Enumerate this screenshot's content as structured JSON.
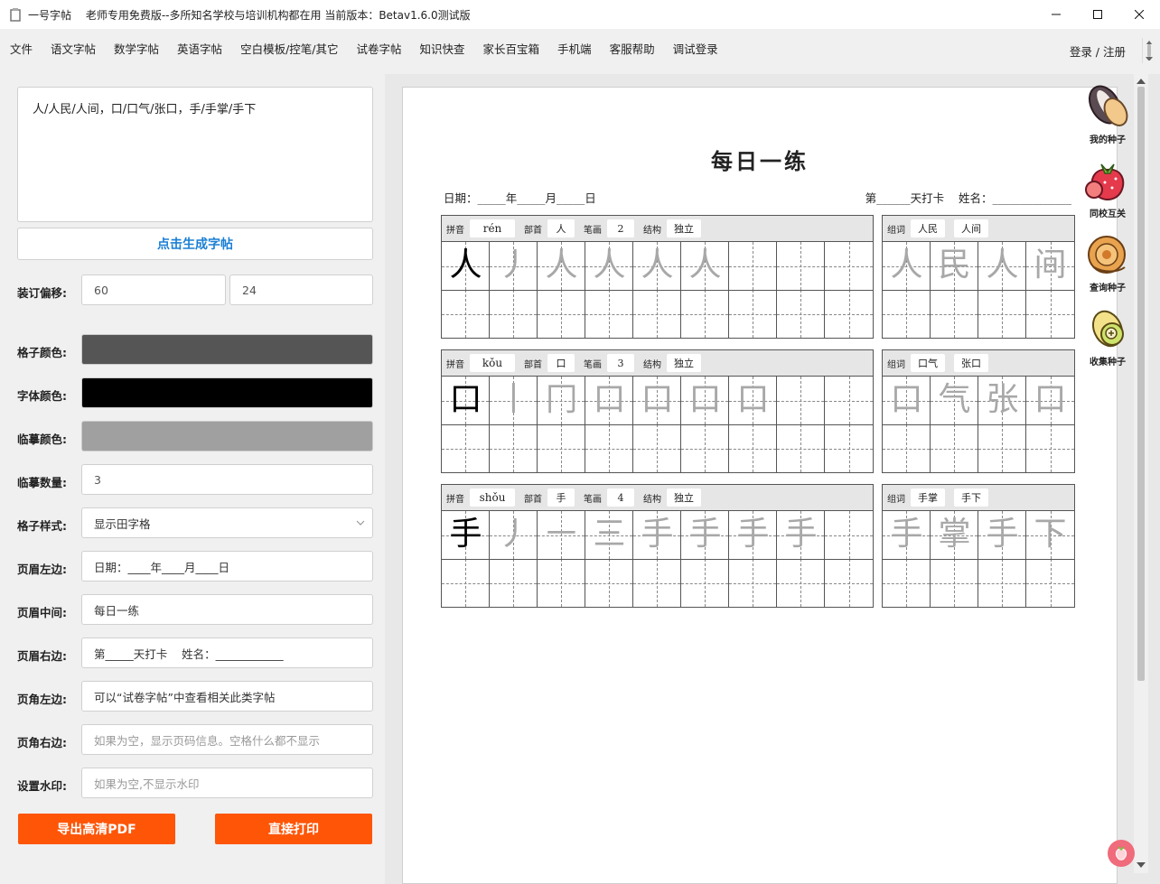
{
  "window": {
    "app_name": "一号字帖",
    "subtitle": "老师专用免费版--多所知名学校与培训机构都在用 当前版本：Betav1.6.0测试版",
    "minimize_icon": "minimize-icon",
    "maximize_icon": "maximize-icon",
    "close_icon": "close-icon"
  },
  "menu": {
    "items": [
      "文件",
      "语文字帖",
      "数学字帖",
      "英语字帖",
      "空白模板/控笔/其它",
      "试卷字帖",
      "知识快查",
      "家长百宝箱",
      "手机端",
      "客服帮助",
      "调试登录"
    ],
    "login": "登录 / 注册"
  },
  "left": {
    "input_text": "人/人民/人间，口/口气/张口，手/手掌/手下",
    "generate_button": "点击生成字帖",
    "binding_label": "装订偏移:",
    "binding_x": "60",
    "binding_y": "24",
    "grid_color_label": "格子颜色:",
    "grid_color": "#555555",
    "font_color_label": "字体颜色:",
    "font_color": "#000000",
    "trace_color_label": "临摹颜色:",
    "trace_color": "#a0a0a0",
    "trace_count_label": "临摹数量:",
    "trace_count": "3",
    "grid_style_label": "格子样式:",
    "grid_style": "显示田字格",
    "header_left_label": "页眉左边:",
    "header_left": "日期：____年____月____日",
    "header_center_label": "页眉中间:",
    "header_center": "每日一练",
    "header_right_label": "页眉右边:",
    "header_right": "第_____天打卡    姓名：____________",
    "footer_left_label": "页角左边:",
    "footer_left": "可以“试卷字帖”中查看相关此类字帖",
    "footer_right_label": "页角右边:",
    "footer_right_placeholder": "如果为空，显示页码信息。空格什么都不显示",
    "watermark_label": "设置水印:",
    "watermark_placeholder": "如果为空,不显示水印",
    "export_button": "导出高清PDF",
    "print_button": "直接打印",
    "accent_color": "#ff5507"
  },
  "sheet": {
    "title": "每日一练",
    "header_left": "日期：_____年_____月_____日",
    "header_right": "第______天打卡    姓名：______________",
    "labels": {
      "pinyin": "拼音",
      "radical": "部首",
      "strokes": "笔画",
      "structure": "结构",
      "words": "组词"
    },
    "blocks": [
      {
        "pinyin": "rén",
        "radical": "人",
        "strokes": "2",
        "structure": "独立",
        "chars": [
          "人",
          "丿",
          "人",
          "人",
          "人",
          "人"
        ],
        "words": [
          "人民",
          "人间"
        ],
        "word_chars": [
          "人",
          "民",
          "人",
          "间"
        ]
      },
      {
        "pinyin": "kǒu",
        "radical": "口",
        "strokes": "3",
        "structure": "独立",
        "chars": [
          "口",
          "丨",
          "冂",
          "口",
          "口",
          "口",
          "口"
        ],
        "words": [
          "口气",
          "张口"
        ],
        "word_chars": [
          "口",
          "气",
          "张",
          "口"
        ]
      },
      {
        "pinyin": "shǒu",
        "radical": "手",
        "strokes": "4",
        "structure": "独立",
        "chars": [
          "手",
          "丿",
          "㇐",
          "三",
          "手",
          "手",
          "手",
          "手"
        ],
        "words": [
          "手掌",
          "手下"
        ],
        "word_chars": [
          "手",
          "掌",
          "手",
          "下"
        ]
      }
    ]
  },
  "seeds": [
    {
      "label": "我的种子",
      "icon": "sunflower-seed-icon"
    },
    {
      "label": "同校互关",
      "icon": "strawberry-icon"
    },
    {
      "label": "查询种子",
      "icon": "snail-seed-icon"
    },
    {
      "label": "收集种子",
      "icon": "add-seed-icon"
    }
  ]
}
